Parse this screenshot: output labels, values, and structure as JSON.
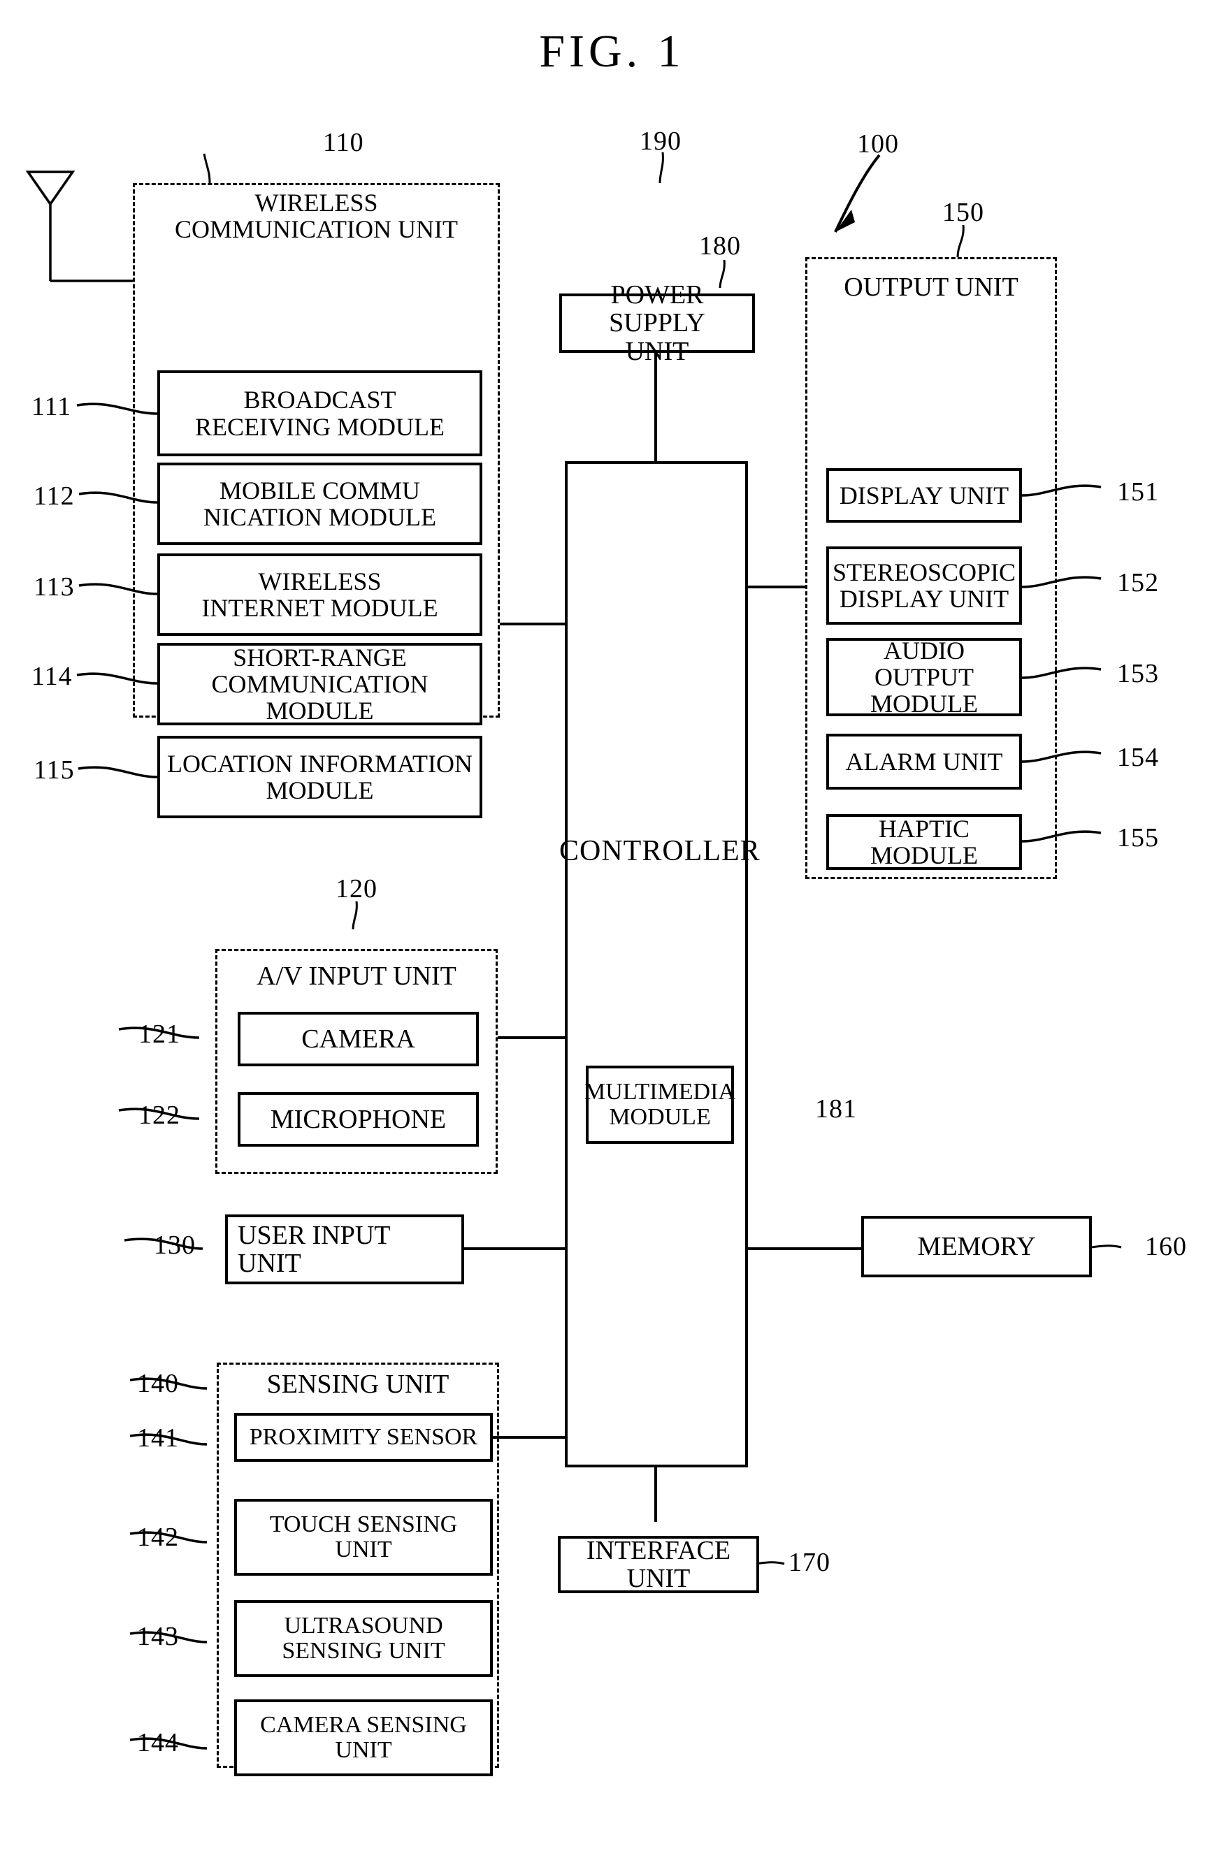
{
  "figure": {
    "title": "FIG.  1",
    "assembly_ref": "100"
  },
  "wireless_unit": {
    "ref": "110",
    "title": "WIRELESS\nCOMMUNICATION UNIT",
    "modules": [
      {
        "ref": "111",
        "label": "BROADCAST\nRECEIVING MODULE"
      },
      {
        "ref": "112",
        "label": "MOBILE COMMU\nNICATION MODULE"
      },
      {
        "ref": "113",
        "label": "WIRELESS\nINTERNET MODULE"
      },
      {
        "ref": "114",
        "label": "SHORT-RANGE\nCOMMUNICATION MODULE"
      },
      {
        "ref": "115",
        "label": "LOCATION INFORMATION\nMODULE"
      }
    ]
  },
  "av_input_unit": {
    "ref": "120",
    "title": "A/V INPUT UNIT",
    "modules": [
      {
        "ref": "121",
        "label": "CAMERA"
      },
      {
        "ref": "122",
        "label": "MICROPHONE"
      }
    ]
  },
  "user_input_unit": {
    "ref": "130",
    "label": "USER INPUT\nUNIT"
  },
  "sensing_unit": {
    "ref": "140",
    "title": "SENSING UNIT",
    "modules": [
      {
        "ref": "141",
        "label": "PROXIMITY SENSOR"
      },
      {
        "ref": "142",
        "label": "TOUCH SENSING\nUNIT"
      },
      {
        "ref": "143",
        "label": "ULTRASOUND\nSENSING UNIT"
      },
      {
        "ref": "144",
        "label": "CAMERA SENSING\nUNIT"
      }
    ]
  },
  "output_unit": {
    "ref": "150",
    "title": "OUTPUT UNIT",
    "modules": [
      {
        "ref": "151",
        "label": "DISPLAY UNIT"
      },
      {
        "ref": "152",
        "label": "STEREOSCOPIC\nDISPLAY UNIT"
      },
      {
        "ref": "153",
        "label": "AUDIO OUTPUT\nMODULE"
      },
      {
        "ref": "154",
        "label": "ALARM UNIT"
      },
      {
        "ref": "155",
        "label": "HAPTIC MODULE"
      }
    ]
  },
  "controller": {
    "ref": "180",
    "label": "CONTROLLER",
    "multimedia_module": {
      "ref": "181",
      "label": "MULTIMEDIA\nMODULE"
    }
  },
  "power_supply_unit": {
    "ref": "190",
    "label": "POWER SUPPLY\nUNIT"
  },
  "memory": {
    "ref": "160",
    "label": "MEMORY"
  },
  "interface_unit": {
    "ref": "170",
    "label": "INTERFACE UNIT"
  },
  "antenna": {
    "icon": "antenna-icon"
  }
}
